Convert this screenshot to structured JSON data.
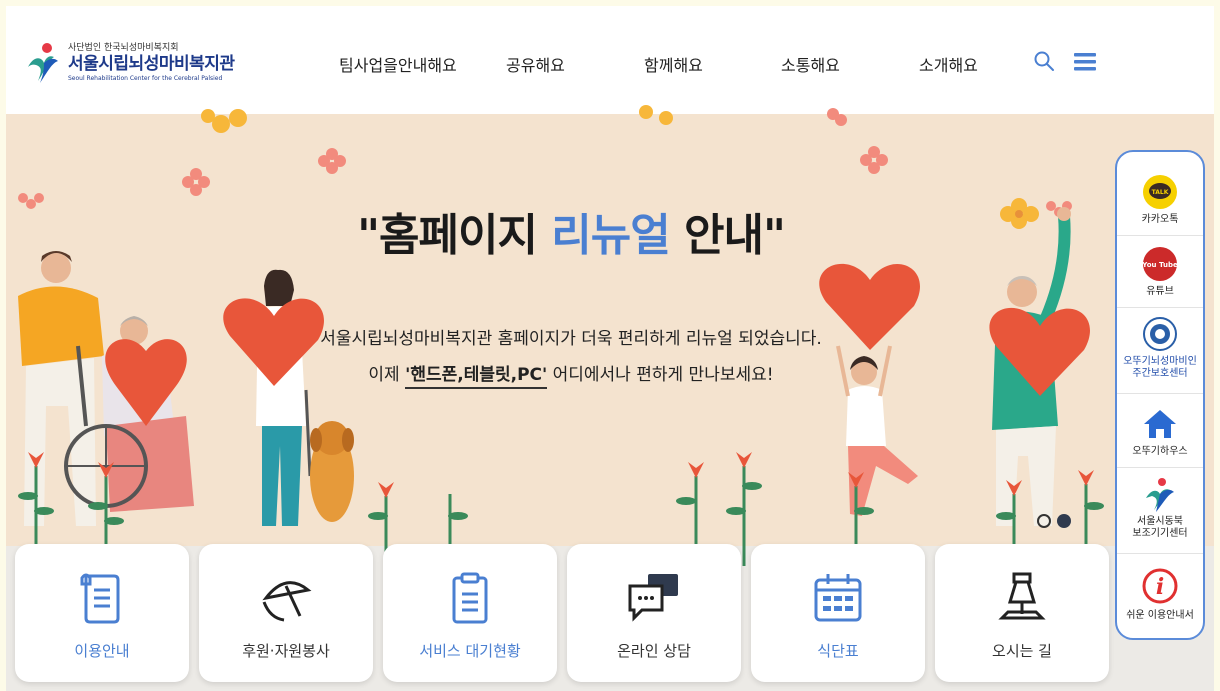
{
  "header": {
    "logo": {
      "sub": "사단법인 한국뇌성마비복지회",
      "main": "서울시립뇌성마비복지관",
      "en": "Seoul Rehabilitation Center for the Cerebral Palsied"
    },
    "nav": [
      {
        "label": "팀사업을안내해요"
      },
      {
        "label": "공유해요"
      },
      {
        "label": "함께해요"
      },
      {
        "label": "소통해요"
      },
      {
        "label": "소개해요"
      }
    ],
    "icons": {
      "search": "search-icon",
      "menu": "hamburger-menu-icon"
    }
  },
  "hero": {
    "title_prefix": "\"홈페이지 ",
    "title_accent": "리뉴얼",
    "title_suffix": " 안내\"",
    "line1": "서울시립뇌성마비복지관 홈페이지가 더욱 편리하게 리뉴얼 되었습니다.",
    "line2_prefix": "이제 ",
    "line2_highlight": "'핸드폰,테블릿,PC'",
    "line2_suffix": " 어디에서나 편하게 만나보세요!"
  },
  "cards": [
    {
      "label": "이용안내",
      "icon": "document-scroll-icon",
      "color": "#4a7fd1"
    },
    {
      "label": "후원·자원봉사",
      "icon": "umbrella-hand-icon",
      "color": "#333333"
    },
    {
      "label": "서비스 대기현황",
      "icon": "clipboard-list-icon",
      "color": "#4a7fd1"
    },
    {
      "label": "온라인 상담",
      "icon": "chat-bubbles-icon",
      "color": "#333333"
    },
    {
      "label": "식단표",
      "icon": "calendar-icon",
      "color": "#4a7fd1"
    },
    {
      "label": "오시는 길",
      "icon": "map-pin-icon",
      "color": "#333333"
    }
  ],
  "quick_menu": [
    {
      "label": "카카오톡",
      "icon": "kakaotalk-icon",
      "icon_text": "TALK"
    },
    {
      "label": "유튜브",
      "icon": "youtube-icon",
      "icon_text": "You Tube"
    },
    {
      "label": "오뚜기뇌성마비인\n주간보호센터",
      "icon": "seal-emblem-icon"
    },
    {
      "label": "오뚜기하우스",
      "icon": "house-icon"
    },
    {
      "label": "서울시동북\n보조기기센터",
      "icon": "center-logo-icon"
    },
    {
      "label": "쉬운 이용안내서",
      "icon": "info-icon",
      "icon_text": "i"
    }
  ],
  "colors": {
    "accent": "#4a7fd1",
    "brand_navy": "#1e3a8a",
    "hero_bg": "#f4e3cf",
    "quick_border": "#5b8bd9"
  }
}
